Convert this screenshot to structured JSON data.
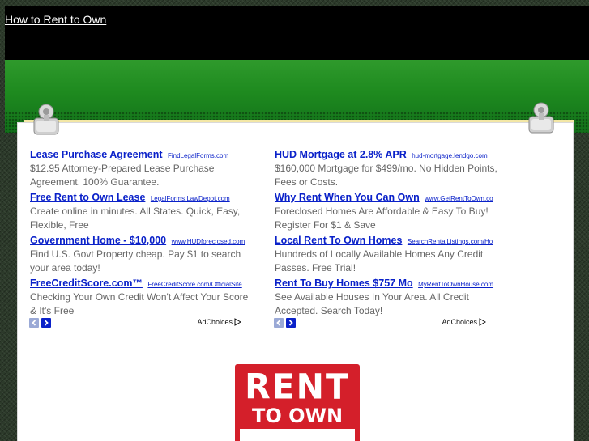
{
  "header": {
    "title": "How to Rent to Own"
  },
  "ads_left": {
    "items": [
      {
        "title": "Lease Purchase Agreement",
        "url": "FindLegalForms.com",
        "desc": "$12.95 Attorney-Prepared Lease Purchase Agreement. 100% Guarantee."
      },
      {
        "title": "Free Rent to Own Lease",
        "url": "LegalForms.LawDepot.com",
        "desc": "Create online in minutes. All States. Quick, Easy, Flexible, Free"
      },
      {
        "title": "Government Home - $10,000",
        "url": "www.HUDforeclosed.com",
        "desc": "Find U.S. Govt Property cheap. Pay $1 to search your area today!"
      },
      {
        "title": "FreeCreditScore.com™",
        "url": "FreeCreditScore.com/OfficialSite",
        "desc": "Checking Your Own Credit Won't Affect Your Score & It's Free"
      }
    ],
    "adchoices": "AdChoices"
  },
  "ads_right": {
    "items": [
      {
        "title": "HUD Mortgage at 2.8% APR",
        "url": "hud-mortgage.lendgo.com",
        "desc": "$160,000 Mortgage for $499/mo. No Hidden Points, Fees or Costs."
      },
      {
        "title": "Why Rent When You Can Own",
        "url": "www.GetRentToOwn.co",
        "desc": "Foreclosed Homes Are Affordable & Easy To Buy! Register For $1 & Save"
      },
      {
        "title": "Local Rent To Own Homes",
        "url": "SearchRentalListings.com/Ho",
        "desc": "Hundreds of Locally Available Homes Any Credit Passes. Free Trial!"
      },
      {
        "title": "Rent To Buy Homes $757 Mo",
        "url": "MyRentToOwnHouse.com",
        "desc": "See Available Houses In Your Area. All Credit Accepted. Search Today!"
      }
    ],
    "adchoices": "AdChoices"
  },
  "sign": {
    "line1": "RENT",
    "line2": "TO OWN"
  },
  "colors": {
    "link": "#0a21c9",
    "desc": "#666666",
    "green": "#1e8a1f",
    "sign_red": "#d41f2a"
  }
}
